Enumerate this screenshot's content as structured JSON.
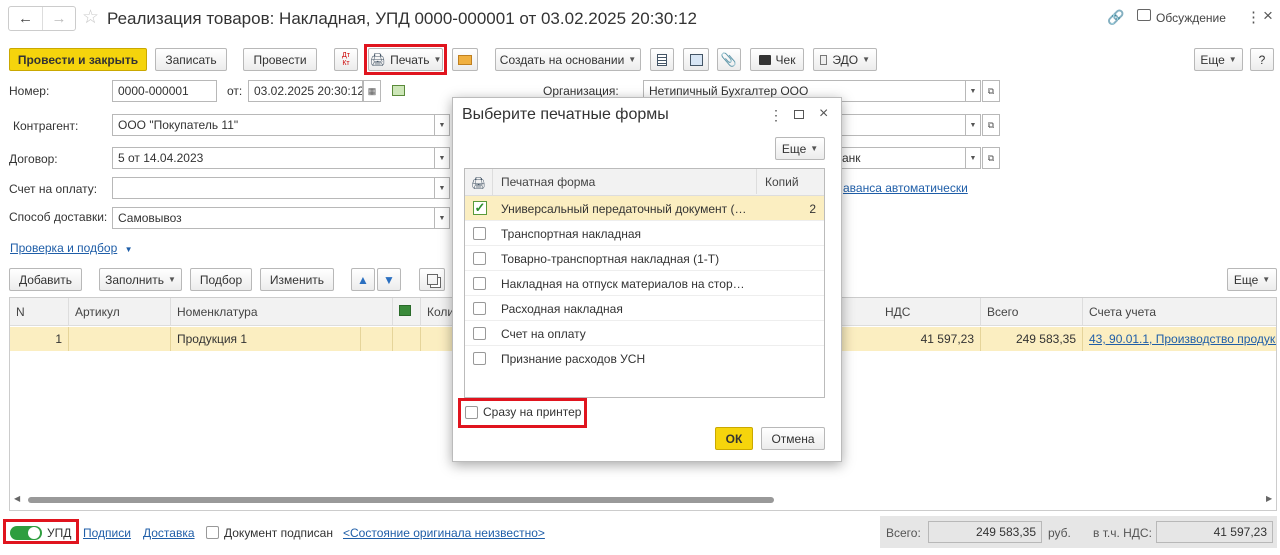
{
  "window": {
    "title": "Реализация товаров: Накладная, УПД 0000-000001 от 03.02.2025 20:30:12",
    "discussion_label": "Обсуждение"
  },
  "toolbar": {
    "post_close": "Провести и закрыть",
    "save": "Записать",
    "post": "Провести",
    "print": "Печать",
    "create_based": "Создать на основании",
    "receipt": "Чек",
    "edo": "ЭДО",
    "more": "Еще",
    "help": "?"
  },
  "form": {
    "number_label": "Номер:",
    "number_value": "0000-000001",
    "date_label": "от:",
    "date_value": "03.02.2025 20:30:12",
    "org_label": "Организация:",
    "org_value": "Нетипичный Бухгалтер ООО",
    "counterparty_label": "Контрагент:",
    "counterparty_value": "ООО \"Покупатель 11\"",
    "contract_label": "Договор:",
    "contract_value": "5 от 14.04.2023",
    "bank_partial": "анк",
    "invoice_label": "Счет на оплату:",
    "invoice_value": "",
    "advance_link": "аванса автоматически",
    "delivery_label": "Способ доставки:",
    "delivery_value": "Самовывоз",
    "check_link": "Проверка и подбор"
  },
  "table_toolbar": {
    "add": "Добавить",
    "fill": "Заполнить",
    "select": "Подбор",
    "change": "Изменить",
    "more": "Еще"
  },
  "table": {
    "columns": [
      "N",
      "Артикул",
      "Номенклатура",
      "Коли",
      "НДС",
      "Всего",
      "Счета учета"
    ],
    "rows": [
      {
        "n": "1",
        "article": "",
        "item": "Продукция 1",
        "vat": "41 597,23",
        "total": "249 583,35",
        "accounts": "43, 90.01.1, Производство продукц"
      }
    ]
  },
  "footer": {
    "toggle_label": "УПД",
    "signatures": "Подписи",
    "delivery": "Доставка",
    "signed_label": "Документ подписан",
    "original_state": "<Состояние оригинала неизвестно>",
    "total_label": "Всего:",
    "total_value": "249 583,35",
    "currency": "руб.",
    "vat_label": "в т.ч. НДС:",
    "vat_value": "41 597,23"
  },
  "dialog": {
    "title": "Выберите печатные формы",
    "more": "Еще",
    "col_form": "Печатная форма",
    "col_copies": "Копий",
    "forms": [
      {
        "name": "Универсальный передаточный документ (У...",
        "copies": "2",
        "checked": true
      },
      {
        "name": "Транспортная накладная",
        "copies": "",
        "checked": false
      },
      {
        "name": "Товарно-транспортная накладная (1-Т)",
        "copies": "",
        "checked": false
      },
      {
        "name": "Накладная на отпуск материалов на сторо...",
        "copies": "",
        "checked": false
      },
      {
        "name": "Расходная накладная",
        "copies": "",
        "checked": false
      },
      {
        "name": "Счет на оплату",
        "copies": "",
        "checked": false
      },
      {
        "name": "Признание расходов УСН",
        "copies": "",
        "checked": false
      }
    ],
    "direct_print": "Сразу на принтер",
    "ok": "ОК",
    "cancel": "Отмена"
  },
  "colors": {
    "accent_yellow": "#f5d40c",
    "highlight_red": "#e0141e",
    "link_blue": "#1f5ea8",
    "row_selected": "#fbeec1",
    "toggle_green": "#2e9e3f"
  }
}
